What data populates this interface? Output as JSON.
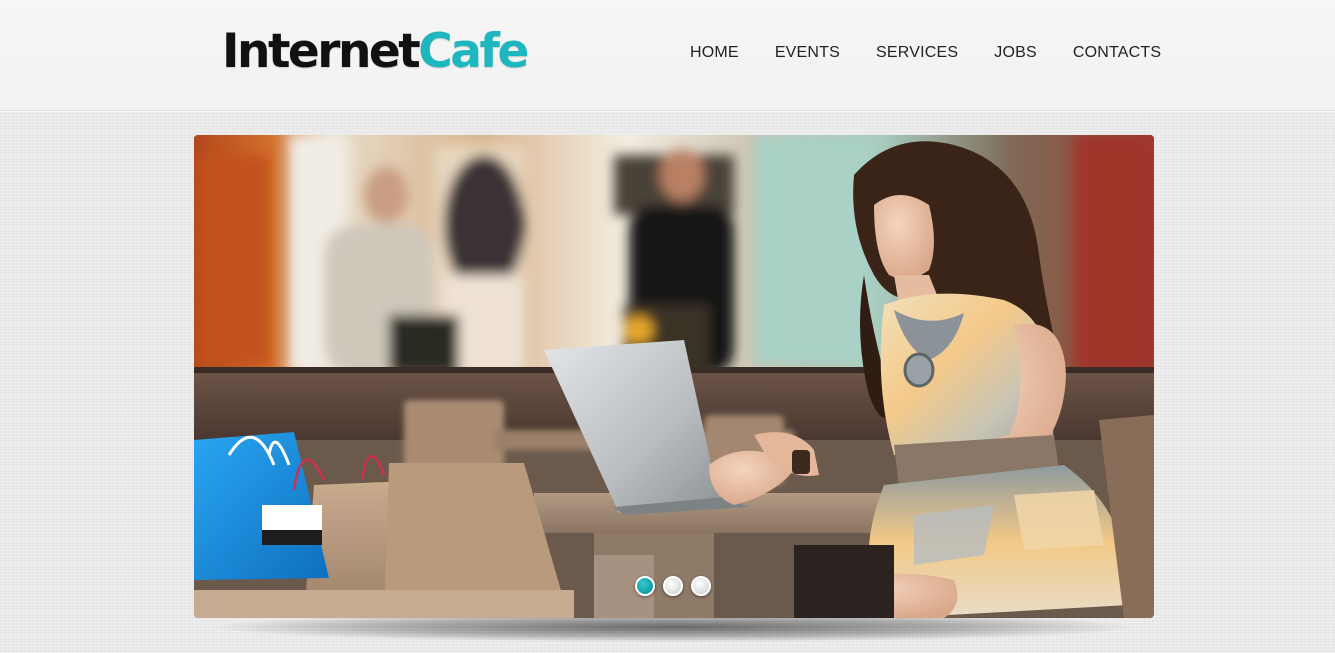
{
  "logo": {
    "part1": "Internet",
    "part2": "Cafe",
    "color_dark": "#111111",
    "color_accent": "#1eb6bf"
  },
  "nav": {
    "items": [
      {
        "label": "HOME"
      },
      {
        "label": "EVENTS"
      },
      {
        "label": "SERVICES"
      },
      {
        "label": "JOBS"
      },
      {
        "label": "CONTACTS"
      }
    ]
  },
  "slider": {
    "image_subject": "photo-woman-with-laptop-in-cafe",
    "slide_count": 3,
    "active_slide": 1,
    "active_dot_color": "#1eb6bf"
  }
}
